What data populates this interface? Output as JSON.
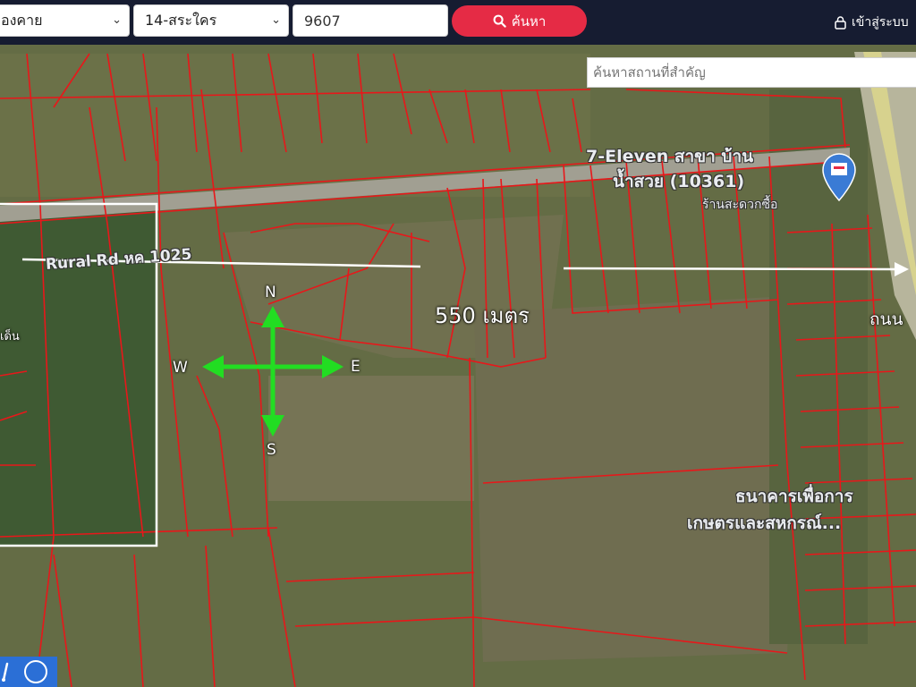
{
  "topbar": {
    "province_value": "องคาย",
    "district_value": "14-สระใคร",
    "parcel_input_value": "9607",
    "search_button_label": "ค้นหา",
    "login_label": "เข้าสู่ระบบ"
  },
  "map": {
    "place_search_placeholder": "ค้นหาสถานที่สำคัญ",
    "road_label": "Rural Rd หค 1025",
    "distance_label": "550 เมตร",
    "poi_711_line1": "7-Eleven สาขา บ้าน",
    "poi_711_line2": "น้ำสวย (10361)",
    "poi_711_subtitle": "ร้านสะดวกซื้อ",
    "poi_bank_line1": "ธนาคารเพื่อการ",
    "poi_bank_line2": "เกษตรและสหกรณ์...",
    "road_right_label": "ถนน",
    "left_edge_label": "เด็น",
    "compass": {
      "n": "N",
      "e": "E",
      "s": "S",
      "w": "W"
    },
    "colors": {
      "parcel_lines": "#e8171a",
      "compass_arrows": "#22dd22",
      "topbar": "#161c31",
      "search_button": "#e52b45"
    }
  },
  "icons": [
    "chevron-down-icon",
    "search-icon",
    "lock-icon",
    "location-pin-icon",
    "ruler-icon",
    "circle-tool-icon"
  ]
}
